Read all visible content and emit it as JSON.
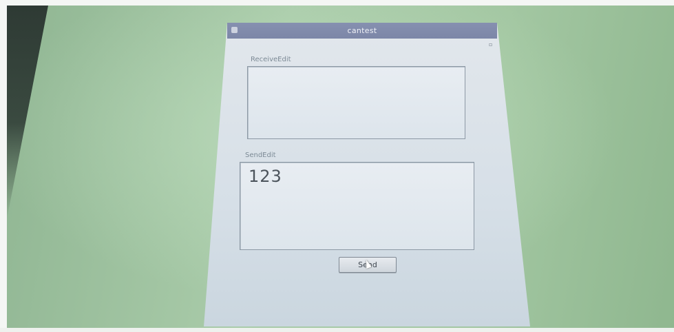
{
  "window": {
    "title": "cantest"
  },
  "receive": {
    "label": "ReceiveEdit",
    "value": ""
  },
  "send": {
    "label": "SendEdit",
    "value": "123",
    "button_label": "Send"
  },
  "colors": {
    "titlebar": "#7c86a7",
    "window_bg": "#d6dfe7",
    "desk_bg": "#a3c7a2"
  },
  "icons": {
    "app": "app-icon",
    "pointer": "mouse-pointer-icon"
  }
}
